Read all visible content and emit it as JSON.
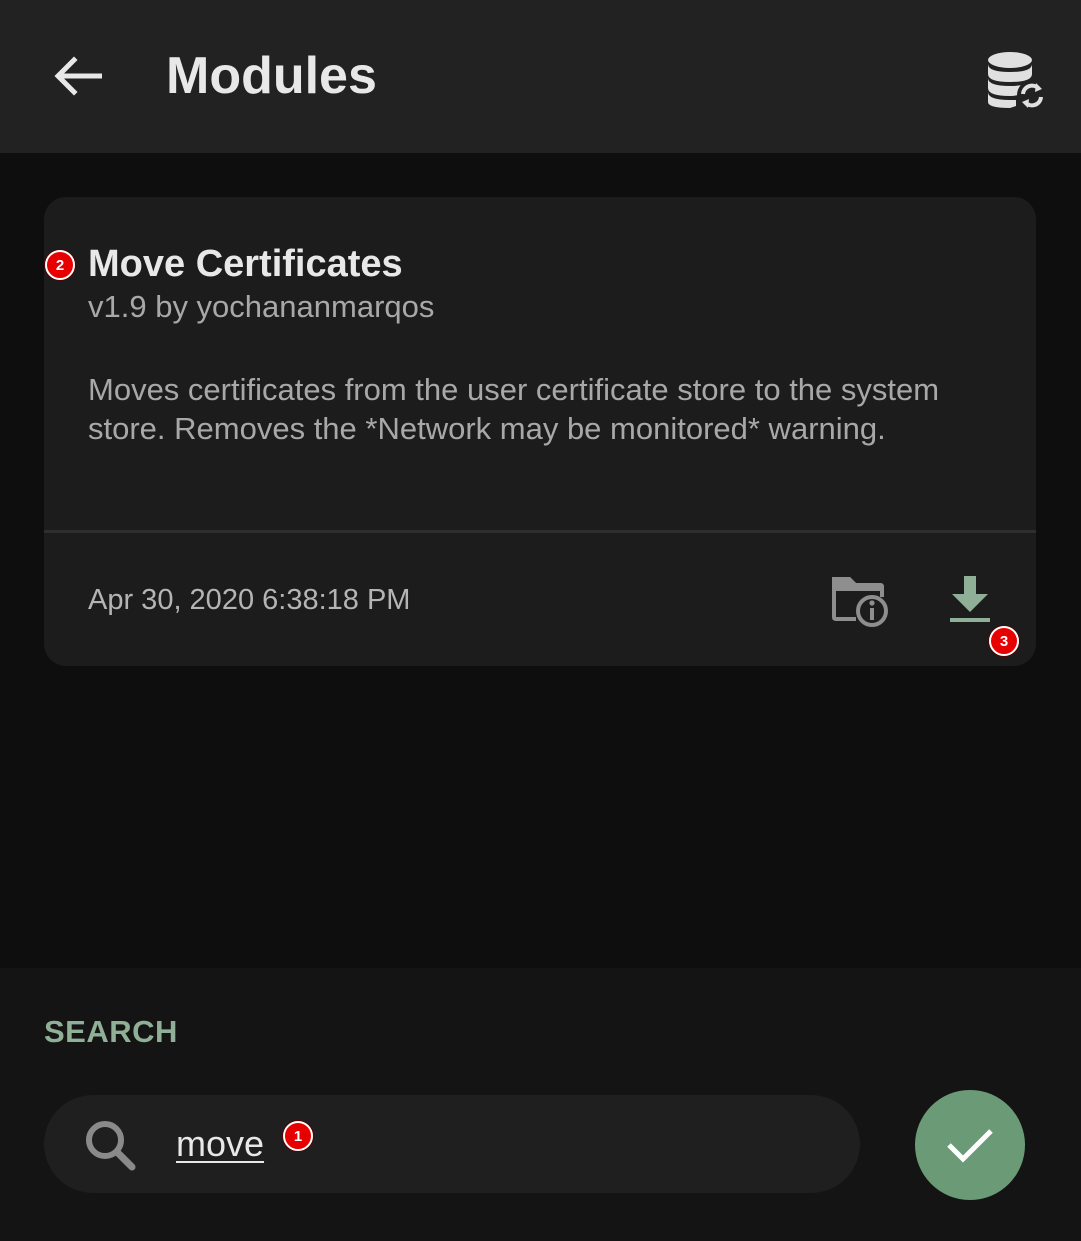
{
  "header": {
    "title": "Modules",
    "back_icon": "arrow-left-icon",
    "repo_icon": "database-sync-icon"
  },
  "module_card": {
    "title": "Move Certificates",
    "subtitle": "v1.9 by yochananmarqos",
    "description": "Moves certificates from the user certificate store to the system store. Removes the *Network may be monitored* warning.",
    "date": "Apr 30, 2020 6:38:18 PM",
    "info_icon": "folder-info-icon",
    "download_icon": "download-icon"
  },
  "search": {
    "label": "SEARCH",
    "value": "move",
    "search_icon": "magnifier-icon",
    "confirm_icon": "checkmark-icon"
  },
  "badges": {
    "search_input": "1",
    "module_title": "2",
    "download_button": "3"
  },
  "colors": {
    "background": "#0e0e0e",
    "toolbar": "#222222",
    "card": "#1c1c1c",
    "accent": "#6b9a76",
    "accent_text": "#8fb096",
    "badge": "#e60000"
  }
}
